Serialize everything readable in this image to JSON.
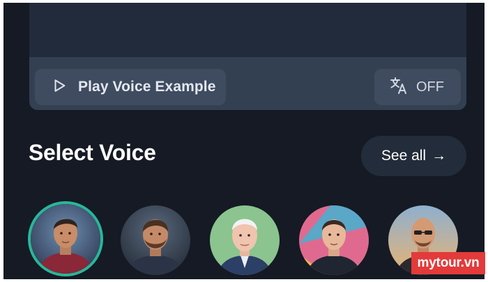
{
  "player": {
    "play_label": "Play Voice Example",
    "play_icon": "play-icon",
    "translate_label": "OFF",
    "translate_icon": "translate-icon"
  },
  "voice_section": {
    "title": "Select Voice",
    "see_all_label": "See all",
    "see_all_arrow": "→"
  },
  "voices": [
    {
      "avatar": "avatar-1",
      "selected": true
    },
    {
      "avatar": "avatar-2",
      "selected": false
    },
    {
      "avatar": "avatar-3",
      "selected": false
    },
    {
      "avatar": "avatar-4",
      "selected": false
    },
    {
      "avatar": "avatar-5",
      "selected": false
    }
  ],
  "watermark": "mytour.vn",
  "colors": {
    "background": "#151a24",
    "card": "#1f2837",
    "card_bar": "#334052",
    "button": "#3f4b5f",
    "accent_selected": "#27b89a",
    "watermark": "#e33a3a"
  }
}
